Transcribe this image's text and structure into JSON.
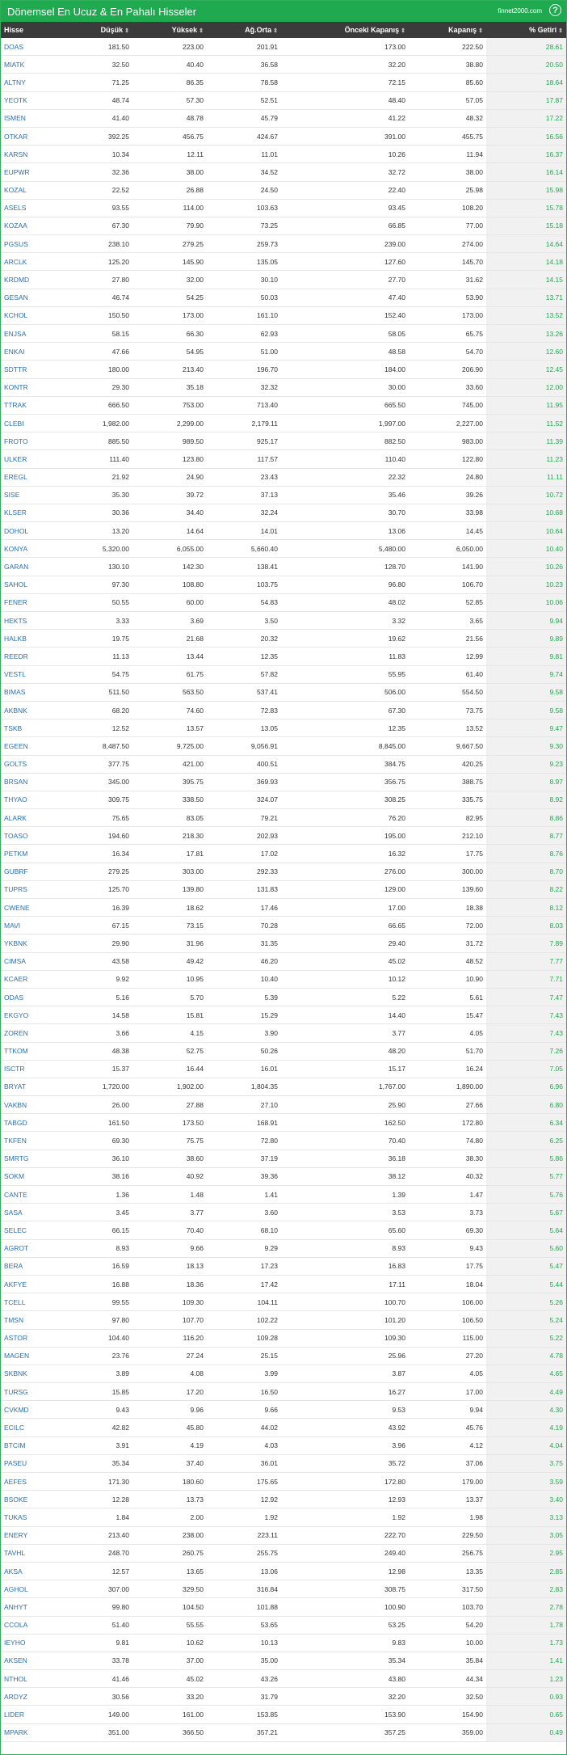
{
  "header": {
    "title": "Dönemsel En Ucuz & En Pahalı Hisseler",
    "brand": "finnet2000.com",
    "help": "?"
  },
  "columns": [
    "Hisse",
    "Düşük",
    "Yüksek",
    "Ağ.Orta",
    "Önceki Kapanış",
    "Kapanış",
    "% Getiri"
  ],
  "sort_icon": "⇕",
  "rows": [
    [
      "DOAS",
      "181.50",
      "223.00",
      "201.91",
      "173.00",
      "222.50",
      "28.61"
    ],
    [
      "MIATK",
      "32.50",
      "40.40",
      "36.58",
      "32.20",
      "38.80",
      "20.50"
    ],
    [
      "ALTNY",
      "71.25",
      "86.35",
      "78.58",
      "72.15",
      "85.60",
      "18.64"
    ],
    [
      "YEOTK",
      "48.74",
      "57.30",
      "52.51",
      "48.40",
      "57.05",
      "17.87"
    ],
    [
      "ISMEN",
      "41.40",
      "48.78",
      "45.79",
      "41.22",
      "48.32",
      "17.22"
    ],
    [
      "OTKAR",
      "392.25",
      "456.75",
      "424.67",
      "391.00",
      "455.75",
      "16.56"
    ],
    [
      "KARSN",
      "10.34",
      "12.11",
      "11.01",
      "10.26",
      "11.94",
      "16.37"
    ],
    [
      "EUPWR",
      "32.36",
      "38.00",
      "34.52",
      "32.72",
      "38.00",
      "16.14"
    ],
    [
      "KOZAL",
      "22.52",
      "26.88",
      "24.50",
      "22.40",
      "25.98",
      "15.98"
    ],
    [
      "ASELS",
      "93.55",
      "114.00",
      "103.63",
      "93.45",
      "108.20",
      "15.78"
    ],
    [
      "KOZAA",
      "67.30",
      "79.90",
      "73.25",
      "66.85",
      "77.00",
      "15.18"
    ],
    [
      "PGSUS",
      "238.10",
      "279.25",
      "259.73",
      "239.00",
      "274.00",
      "14.64"
    ],
    [
      "ARCLK",
      "125.20",
      "145.90",
      "135.05",
      "127.60",
      "145.70",
      "14.18"
    ],
    [
      "KRDMD",
      "27.80",
      "32.00",
      "30.10",
      "27.70",
      "31.62",
      "14.15"
    ],
    [
      "GESAN",
      "46.74",
      "54.25",
      "50.03",
      "47.40",
      "53.90",
      "13.71"
    ],
    [
      "KCHOL",
      "150.50",
      "173.00",
      "161.10",
      "152.40",
      "173.00",
      "13.52"
    ],
    [
      "ENJSA",
      "58.15",
      "66.30",
      "62.93",
      "58.05",
      "65.75",
      "13.26"
    ],
    [
      "ENKAI",
      "47.66",
      "54.95",
      "51.00",
      "48.58",
      "54.70",
      "12.60"
    ],
    [
      "SDTTR",
      "180.00",
      "213.40",
      "196.70",
      "184.00",
      "206.90",
      "12.45"
    ],
    [
      "KONTR",
      "29.30",
      "35.18",
      "32.32",
      "30.00",
      "33.60",
      "12.00"
    ],
    [
      "TTRAK",
      "666.50",
      "753.00",
      "713.40",
      "665.50",
      "745.00",
      "11.95"
    ],
    [
      "CLEBI",
      "1,982.00",
      "2,299.00",
      "2,179.11",
      "1,997.00",
      "2,227.00",
      "11.52"
    ],
    [
      "FROTO",
      "885.50",
      "989.50",
      "925.17",
      "882.50",
      "983.00",
      "11.39"
    ],
    [
      "ULKER",
      "111.40",
      "123.80",
      "117.57",
      "110.40",
      "122.80",
      "11.23"
    ],
    [
      "EREGL",
      "21.92",
      "24.90",
      "23.43",
      "22.32",
      "24.80",
      "11.11"
    ],
    [
      "SISE",
      "35.30",
      "39.72",
      "37.13",
      "35.46",
      "39.26",
      "10.72"
    ],
    [
      "KLSER",
      "30.36",
      "34.40",
      "32.24",
      "30.70",
      "33.98",
      "10.68"
    ],
    [
      "DOHOL",
      "13.20",
      "14.64",
      "14.01",
      "13.06",
      "14.45",
      "10.64"
    ],
    [
      "KONYA",
      "5,320.00",
      "6,055.00",
      "5,660.40",
      "5,480.00",
      "6,050.00",
      "10.40"
    ],
    [
      "GARAN",
      "130.10",
      "142.30",
      "138.41",
      "128.70",
      "141.90",
      "10.26"
    ],
    [
      "SAHOL",
      "97.30",
      "108.80",
      "103.75",
      "96.80",
      "106.70",
      "10.23"
    ],
    [
      "FENER",
      "50.55",
      "60.00",
      "54.83",
      "48.02",
      "52.85",
      "10.06"
    ],
    [
      "HEKTS",
      "3.33",
      "3.69",
      "3.50",
      "3.32",
      "3.65",
      "9.94"
    ],
    [
      "HALKB",
      "19.75",
      "21.68",
      "20.32",
      "19.62",
      "21.56",
      "9.89"
    ],
    [
      "REEDR",
      "11.13",
      "13.44",
      "12.35",
      "11.83",
      "12.99",
      "9.81"
    ],
    [
      "VESTL",
      "54.75",
      "61.75",
      "57.82",
      "55.95",
      "61.40",
      "9.74"
    ],
    [
      "BIMAS",
      "511.50",
      "563.50",
      "537.41",
      "506.00",
      "554.50",
      "9.58"
    ],
    [
      "AKBNK",
      "68.20",
      "74.60",
      "72.83",
      "67.30",
      "73.75",
      "9.58"
    ],
    [
      "TSKB",
      "12.52",
      "13.57",
      "13.05",
      "12.35",
      "13.52",
      "9.47"
    ],
    [
      "EGEEN",
      "8,487.50",
      "9,725.00",
      "9,056.91",
      "8,845.00",
      "9,667.50",
      "9.30"
    ],
    [
      "GOLTS",
      "377.75",
      "421.00",
      "400.51",
      "384.75",
      "420.25",
      "9.23"
    ],
    [
      "BRSAN",
      "345.00",
      "395.75",
      "369.93",
      "356.75",
      "388.75",
      "8.97"
    ],
    [
      "THYAO",
      "309.75",
      "338.50",
      "324.07",
      "308.25",
      "335.75",
      "8.92"
    ],
    [
      "ALARK",
      "75.65",
      "83.05",
      "79.21",
      "76.20",
      "82.95",
      "8.86"
    ],
    [
      "TOASO",
      "194.60",
      "218.30",
      "202.93",
      "195.00",
      "212.10",
      "8.77"
    ],
    [
      "PETKM",
      "16.34",
      "17.81",
      "17.02",
      "16.32",
      "17.75",
      "8.76"
    ],
    [
      "GUBRF",
      "279.25",
      "303.00",
      "292.33",
      "276.00",
      "300.00",
      "8.70"
    ],
    [
      "TUPRS",
      "125.70",
      "139.80",
      "131.83",
      "129.00",
      "139.60",
      "8.22"
    ],
    [
      "CWENE",
      "16.39",
      "18.62",
      "17.46",
      "17.00",
      "18.38",
      "8.12"
    ],
    [
      "MAVI",
      "67.15",
      "73.15",
      "70.28",
      "66.65",
      "72.00",
      "8.03"
    ],
    [
      "YKBNK",
      "29.90",
      "31.96",
      "31.35",
      "29.40",
      "31.72",
      "7.89"
    ],
    [
      "CIMSA",
      "43.58",
      "49.42",
      "46.20",
      "45.02",
      "48.52",
      "7.77"
    ],
    [
      "KCAER",
      "9.92",
      "10.95",
      "10.40",
      "10.12",
      "10.90",
      "7.71"
    ],
    [
      "ODAS",
      "5.16",
      "5.70",
      "5.39",
      "5.22",
      "5.61",
      "7.47"
    ],
    [
      "EKGYO",
      "14.58",
      "15.81",
      "15.29",
      "14.40",
      "15.47",
      "7.43"
    ],
    [
      "ZOREN",
      "3.66",
      "4.15",
      "3.90",
      "3.77",
      "4.05",
      "7.43"
    ],
    [
      "TTKOM",
      "48.38",
      "52.75",
      "50.26",
      "48.20",
      "51.70",
      "7.26"
    ],
    [
      "ISCTR",
      "15.37",
      "16.44",
      "16.01",
      "15.17",
      "16.24",
      "7.05"
    ],
    [
      "BRYAT",
      "1,720.00",
      "1,902.00",
      "1,804.35",
      "1,767.00",
      "1,890.00",
      "6.96"
    ],
    [
      "VAKBN",
      "26.00",
      "27.88",
      "27.10",
      "25.90",
      "27.66",
      "6.80"
    ],
    [
      "TABGD",
      "161.50",
      "173.50",
      "168.91",
      "162.50",
      "172.80",
      "6.34"
    ],
    [
      "TKFEN",
      "69.30",
      "75.75",
      "72.80",
      "70.40",
      "74.80",
      "6.25"
    ],
    [
      "SMRTG",
      "36.10",
      "38.60",
      "37.19",
      "36.18",
      "38.30",
      "5.86"
    ],
    [
      "SOKM",
      "38.16",
      "40.92",
      "39.36",
      "38.12",
      "40.32",
      "5.77"
    ],
    [
      "CANTE",
      "1.36",
      "1.48",
      "1.41",
      "1.39",
      "1.47",
      "5.76"
    ],
    [
      "SASA",
      "3.45",
      "3.77",
      "3.60",
      "3.53",
      "3.73",
      "5.67"
    ],
    [
      "SELEC",
      "66.15",
      "70.40",
      "68.10",
      "65.60",
      "69.30",
      "5.64"
    ],
    [
      "AGROT",
      "8.93",
      "9.66",
      "9.29",
      "8.93",
      "9.43",
      "5.60"
    ],
    [
      "BERA",
      "16.59",
      "18.13",
      "17.23",
      "16.83",
      "17.75",
      "5.47"
    ],
    [
      "AKFYE",
      "16.88",
      "18.36",
      "17.42",
      "17.11",
      "18.04",
      "5.44"
    ],
    [
      "TCELL",
      "99.55",
      "109.30",
      "104.11",
      "100.70",
      "106.00",
      "5.26"
    ],
    [
      "TMSN",
      "97.80",
      "107.70",
      "102.22",
      "101.20",
      "106.50",
      "5.24"
    ],
    [
      "ASTOR",
      "104.40",
      "116.20",
      "109.28",
      "109.30",
      "115.00",
      "5.22"
    ],
    [
      "MAGEN",
      "23.76",
      "27.24",
      "25.15",
      "25.96",
      "27.20",
      "4.78"
    ],
    [
      "SKBNK",
      "3.89",
      "4.08",
      "3.99",
      "3.87",
      "4.05",
      "4.65"
    ],
    [
      "TURSG",
      "15.85",
      "17.20",
      "16.50",
      "16.27",
      "17.00",
      "4.49"
    ],
    [
      "CVKMD",
      "9.43",
      "9.96",
      "9.66",
      "9.53",
      "9.94",
      "4.30"
    ],
    [
      "ECILC",
      "42.82",
      "45.80",
      "44.02",
      "43.92",
      "45.76",
      "4.19"
    ],
    [
      "BTCIM",
      "3.91",
      "4.19",
      "4.03",
      "3.96",
      "4.12",
      "4.04"
    ],
    [
      "PASEU",
      "35.34",
      "37.40",
      "36.01",
      "35.72",
      "37.06",
      "3.75"
    ],
    [
      "AEFES",
      "171.30",
      "180.60",
      "175.65",
      "172.80",
      "179.00",
      "3.59"
    ],
    [
      "BSOKE",
      "12.28",
      "13.73",
      "12.92",
      "12.93",
      "13.37",
      "3.40"
    ],
    [
      "TUKAS",
      "1.84",
      "2.00",
      "1.92",
      "1.92",
      "1.98",
      "3.13"
    ],
    [
      "ENERY",
      "213.40",
      "238.00",
      "223.11",
      "222.70",
      "229.50",
      "3.05"
    ],
    [
      "TAVHL",
      "248.70",
      "260.75",
      "255.75",
      "249.40",
      "256.75",
      "2.95"
    ],
    [
      "AKSA",
      "12.57",
      "13.65",
      "13.06",
      "12.98",
      "13.35",
      "2.85"
    ],
    [
      "AGHOL",
      "307.00",
      "329.50",
      "316.84",
      "308.75",
      "317.50",
      "2.83"
    ],
    [
      "ANHYT",
      "99.80",
      "104.50",
      "101.88",
      "100.90",
      "103.70",
      "2.78"
    ],
    [
      "CCOLA",
      "51.40",
      "55.55",
      "53.65",
      "53.25",
      "54.20",
      "1.78"
    ],
    [
      "IEYHO",
      "9.81",
      "10.62",
      "10.13",
      "9.83",
      "10.00",
      "1.73"
    ],
    [
      "AKSEN",
      "33.78",
      "37.00",
      "35.00",
      "35.34",
      "35.84",
      "1.41"
    ],
    [
      "NTHOL",
      "41.46",
      "45.02",
      "43.26",
      "43.80",
      "44.34",
      "1.23"
    ],
    [
      "ARDYZ",
      "30.56",
      "33.20",
      "31.79",
      "32.20",
      "32.50",
      "0.93"
    ],
    [
      "LIDER",
      "149.00",
      "161.00",
      "153.85",
      "153.90",
      "154.90",
      "0.65"
    ],
    [
      "MPARK",
      "351.00",
      "366.50",
      "357.21",
      "357.25",
      "359.00",
      "0.49"
    ]
  ]
}
